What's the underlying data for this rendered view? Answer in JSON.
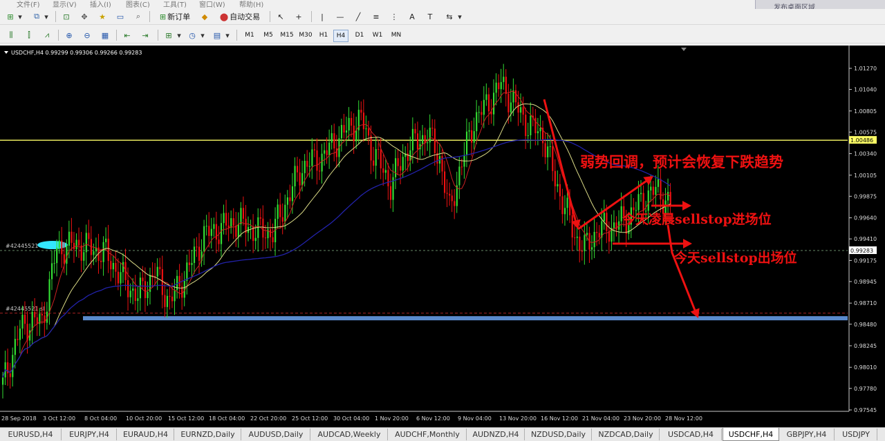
{
  "menu": [
    "文件(F)",
    "显示(V)",
    "插入(I)",
    "图表(C)",
    "工具(T)",
    "窗口(W)",
    "帮助(H)"
  ],
  "search": {
    "placeholder": "发布桌面区域"
  },
  "toolbar": {
    "new_order": "新订单",
    "auto_trade": "自动交易"
  },
  "timeframes": [
    "M1",
    "M5",
    "M15",
    "M30",
    "H1",
    "H4",
    "D1",
    "W1",
    "MN"
  ],
  "active_timeframe": "H4",
  "chart": {
    "header": "USDCHF,H4  0.99299 0.99306 0.99266 0.99283",
    "order_label": "#42445521",
    "order_label2": "#42445521 sl",
    "annotation1": "弱势回调，预计会恢复下跌趋势",
    "annotation2": "今天凌晨sellstop进场位",
    "annotation3": "今天sellstop出场位"
  },
  "chart_data": {
    "type": "candlestick",
    "symbol": "USDCHF",
    "timeframe": "H4",
    "ohlc_header": [
      0.99299,
      0.99306,
      0.99266,
      0.99283
    ],
    "y_ticks": [
      "1.01270",
      "1.01040",
      "1.00805",
      "1.00575",
      "1.00340",
      "1.00105",
      "0.99875",
      "0.99640",
      "0.99410",
      "0.99175",
      "0.98945",
      "0.98710",
      "0.98480",
      "0.98245",
      "0.98010",
      "0.97780",
      "0.97545"
    ],
    "x_ticks": [
      "28 Sep 2018",
      "3 Oct 12:00",
      "8 Oct 04:00",
      "10 Oct 20:00",
      "15 Oct 12:00",
      "18 Oct 04:00",
      "22 Oct 20:00",
      "25 Oct 12:00",
      "30 Oct 04:00",
      "1 Nov 20:00",
      "6 Nov 12:00",
      "9 Nov 04:00",
      "13 Nov 20:00",
      "16 Nov 12:00",
      "21 Nov 04:00",
      "23 Nov 20:00",
      "28 Nov 12:00"
    ],
    "ylim": [
      0.97545,
      1.0127
    ],
    "price_levels": {
      "resistance": "1.00486",
      "current": "0.99283"
    },
    "colors": {
      "bull": "#33dd33",
      "bear": "#ee1111",
      "ma_fast": "#cc2222",
      "ma_mid": "#dddd88",
      "ma_slow": "#2222aa"
    }
  },
  "tabs": [
    "EURUSD,H4",
    "EURJPY,H4",
    "EURAUD,H4",
    "EURNZD,Daily",
    "AUDUSD,Daily",
    "AUDCAD,Weekly",
    "AUDCHF,Monthly",
    "AUDNZD,H4",
    "NZDUSD,Daily",
    "NZDCAD,Daily",
    "USDCAD,H4",
    "USDCHF,H4",
    "GBPJPY,H4",
    "USDJPY"
  ],
  "active_tab": "USDCHF,H4"
}
